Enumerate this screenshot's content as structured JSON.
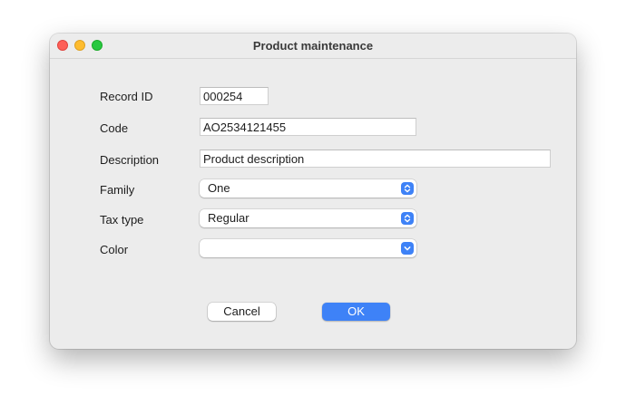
{
  "window": {
    "title": "Product maintenance"
  },
  "form": {
    "record_id": {
      "label": "Record ID",
      "value": "000254"
    },
    "code": {
      "label": "Code",
      "value": "AO2534121455"
    },
    "description": {
      "label": "Description",
      "value": "Product description"
    },
    "family": {
      "label": "Family",
      "value": "One"
    },
    "tax_type": {
      "label": "Tax type",
      "value": "Regular"
    },
    "color": {
      "label": "Color",
      "value": ""
    }
  },
  "buttons": {
    "cancel_label": "Cancel",
    "ok_label": "OK"
  },
  "colors": {
    "accent": "#3e82f7",
    "close": "#fe5f57",
    "minimize": "#febc2e",
    "zoom": "#28c840"
  }
}
